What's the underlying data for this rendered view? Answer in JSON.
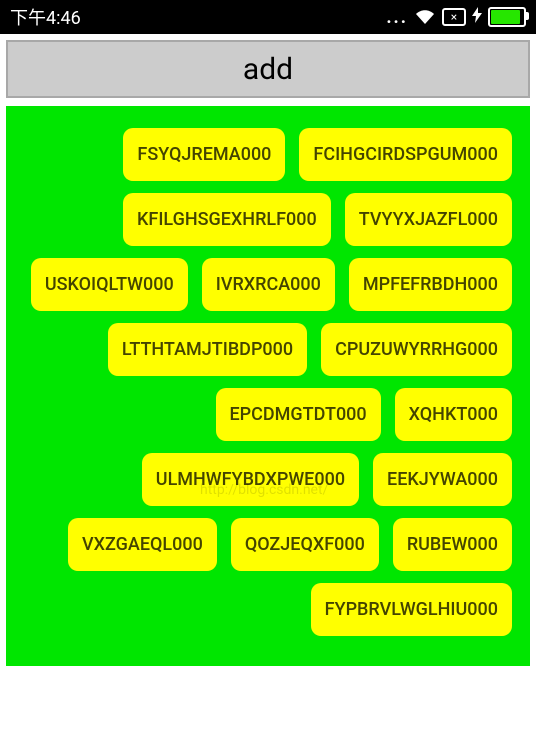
{
  "status_bar": {
    "time": "下午4:46",
    "dots": "...",
    "x_indicator": "×",
    "bolt": "⚡"
  },
  "add_button_label": "add",
  "tags": [
    "FSYQJREMA000",
    "FCIHGCIRDSPGUM000",
    "KFILGHSGEXHRLF000",
    "TVYYXJAZFL000",
    "USKOIQLTW000",
    "IVRXRCA000",
    "MPFEFRBDH000",
    "LTTHTAMJTIBDP000",
    "CPUZUWYRRHG000",
    "EPCDMGTDT000",
    "XQHKT000",
    "ULMHWFYBDXPWE000",
    "EEKJYWA000",
    "VXZGAEQL000",
    "QOZJEQXF000",
    "RUBEW000",
    "FYPBRVLWGLHIU000"
  ],
  "watermark": "http://blog.csdn.net/"
}
